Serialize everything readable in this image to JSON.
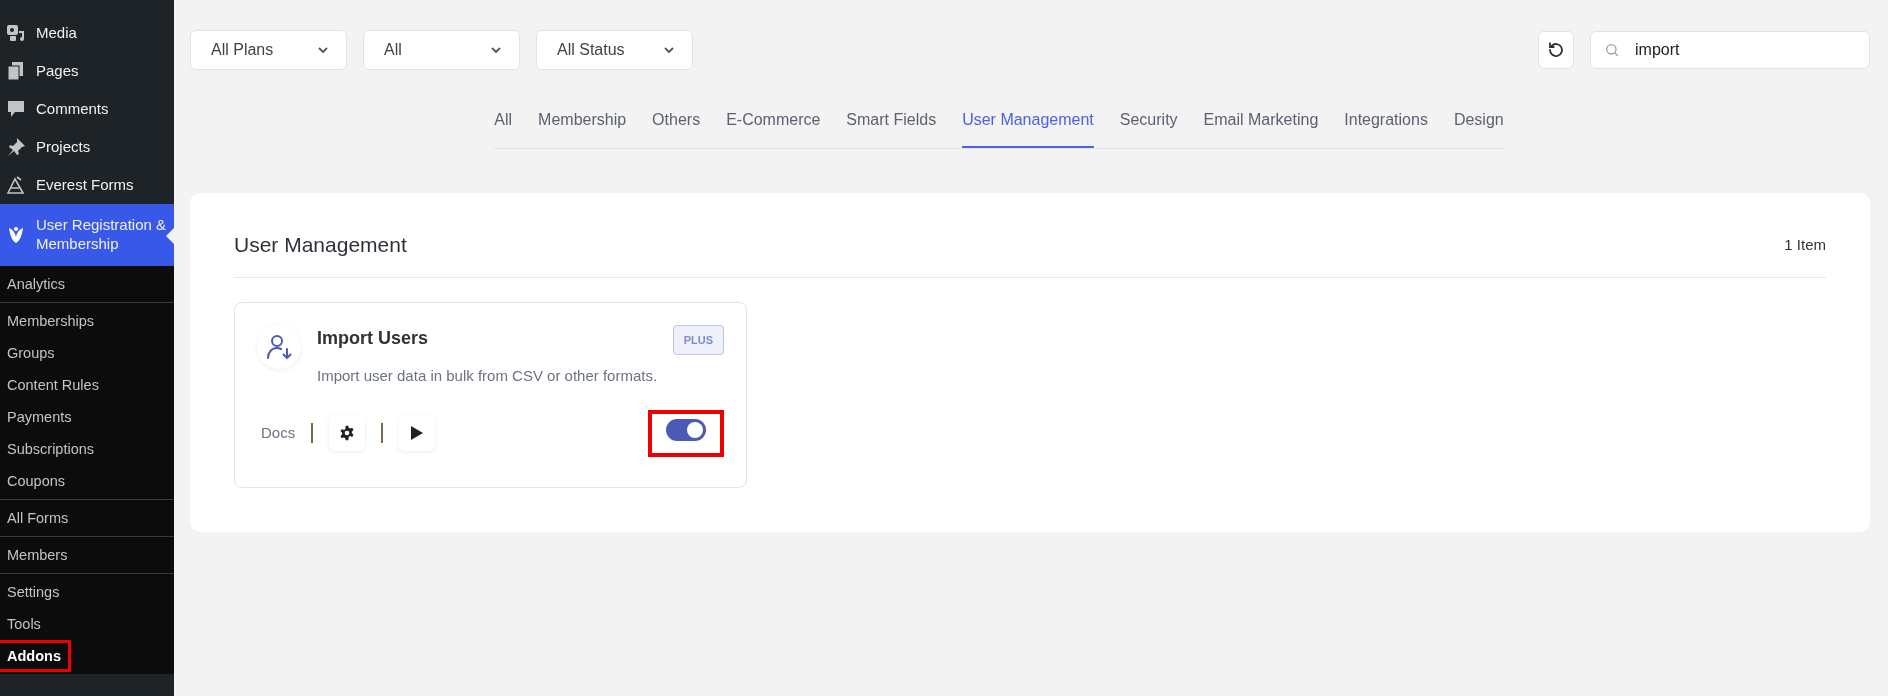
{
  "sidebar": {
    "items": [
      {
        "label": "Media",
        "selected": false
      },
      {
        "label": "Pages",
        "selected": false
      },
      {
        "label": "Comments",
        "selected": false
      },
      {
        "label": "Projects",
        "selected": false
      },
      {
        "label": "Everest Forms",
        "selected": false
      },
      {
        "label": "User Registration & Membership",
        "selected": true
      }
    ],
    "submenu": [
      [
        {
          "label": "Analytics",
          "selected": false,
          "highlighted": false
        }
      ],
      [
        {
          "label": "Memberships",
          "selected": false,
          "highlighted": false
        },
        {
          "label": "Groups",
          "selected": false,
          "highlighted": false
        },
        {
          "label": "Content Rules",
          "selected": false,
          "highlighted": false
        },
        {
          "label": "Payments",
          "selected": false,
          "highlighted": false
        },
        {
          "label": "Subscriptions",
          "selected": false,
          "highlighted": false
        },
        {
          "label": "Coupons",
          "selected": false,
          "highlighted": false
        }
      ],
      [
        {
          "label": "All Forms",
          "selected": false,
          "highlighted": false
        }
      ],
      [
        {
          "label": "Members",
          "selected": false,
          "highlighted": false
        }
      ],
      [
        {
          "label": "Settings",
          "selected": false,
          "highlighted": false
        },
        {
          "label": "Tools",
          "selected": false,
          "highlighted": false
        },
        {
          "label": "Addons",
          "selected": true,
          "highlighted": true
        }
      ]
    ]
  },
  "filters": [
    {
      "value": "All Plans"
    },
    {
      "value": "All"
    },
    {
      "value": "All Status"
    }
  ],
  "search": {
    "value": "import"
  },
  "tabs": [
    {
      "label": "All",
      "selected": false
    },
    {
      "label": "Membership",
      "selected": false
    },
    {
      "label": "Others",
      "selected": false
    },
    {
      "label": "E-Commerce",
      "selected": false
    },
    {
      "label": "Smart Fields",
      "selected": false
    },
    {
      "label": "User Management",
      "selected": true
    },
    {
      "label": "Security",
      "selected": false
    },
    {
      "label": "Email Marketing",
      "selected": false
    },
    {
      "label": "Integrations",
      "selected": false
    },
    {
      "label": "Design",
      "selected": false
    }
  ],
  "section": {
    "title": "User Management",
    "count": "1 Item",
    "addons": [
      {
        "name": "Import Users",
        "plan": "PLUS",
        "description": "Import user data in bulk from CSV or other formats.",
        "docs": "Docs",
        "on": true,
        "highlighted": true
      }
    ]
  }
}
